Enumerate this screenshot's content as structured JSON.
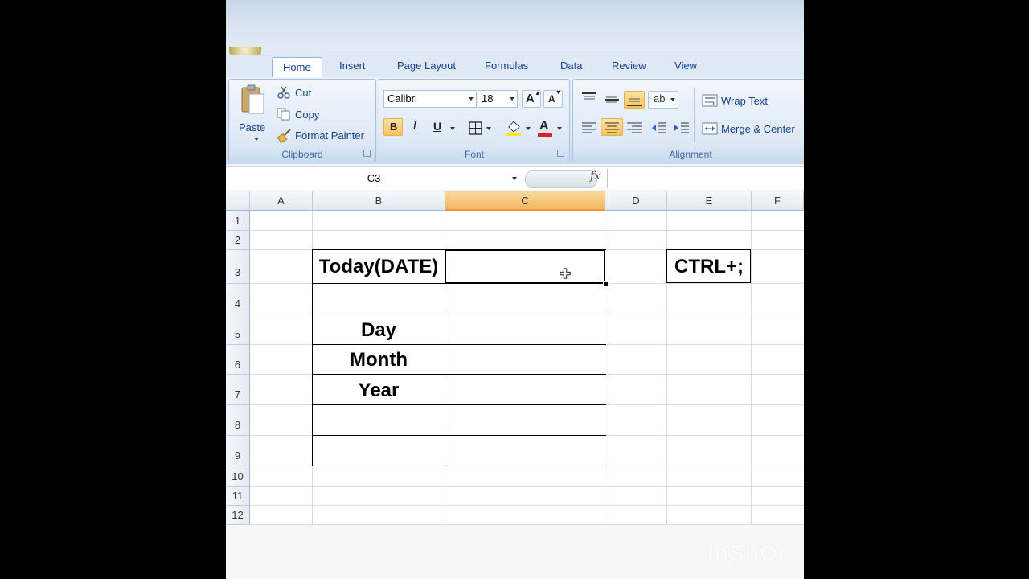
{
  "ribbon": {
    "tabs": [
      "Home",
      "Insert",
      "Page Layout",
      "Formulas",
      "Data",
      "Review",
      "View"
    ],
    "clipboard": {
      "paste": "Paste",
      "cut": "Cut",
      "copy": "Copy",
      "format_painter": "Format Painter",
      "label": "Clipboard"
    },
    "font": {
      "name": "Calibri",
      "size": "18",
      "bold": "B",
      "italic": "I",
      "underline": "U",
      "font_color": "A",
      "label": "Font"
    },
    "alignment": {
      "wrap_text": "Wrap Text",
      "merge_center": "Merge & Center",
      "label": "Alignment"
    }
  },
  "formula_bar": {
    "name_box": "C3",
    "fx": "fx",
    "formula": ""
  },
  "grid": {
    "columns": [
      "A",
      "B",
      "C",
      "D",
      "E",
      "F"
    ],
    "selected_column": "C",
    "rows": [
      "1",
      "2",
      "3",
      "4",
      "5",
      "6",
      "7",
      "8",
      "9",
      "10",
      "11",
      "12"
    ],
    "cells": {
      "B3": "Today(DATE)",
      "B5": "Day",
      "B6": "Month",
      "B7": "Year",
      "E3": "CTRL+;"
    },
    "active_cell": "C3"
  },
  "watermark": "InShOt",
  "colors": {
    "selected_header": "#f1b95f",
    "ribbon_text": "#15428b",
    "highlight": "#f7c35a"
  },
  "icons": [
    "office-button-icon",
    "cut-icon",
    "copy-icon",
    "format-painter-icon",
    "paste-icon",
    "grow-font-icon",
    "shrink-font-icon",
    "borders-icon",
    "fill-color-icon",
    "font-color-icon",
    "align-top-icon",
    "align-middle-icon",
    "align-bottom-icon",
    "orientation-icon",
    "align-left-icon",
    "align-center-icon",
    "align-right-icon",
    "decrease-indent-icon",
    "increase-indent-icon",
    "wrap-text-icon",
    "merge-center-icon",
    "cell-cursor-icon",
    "fx-icon"
  ]
}
